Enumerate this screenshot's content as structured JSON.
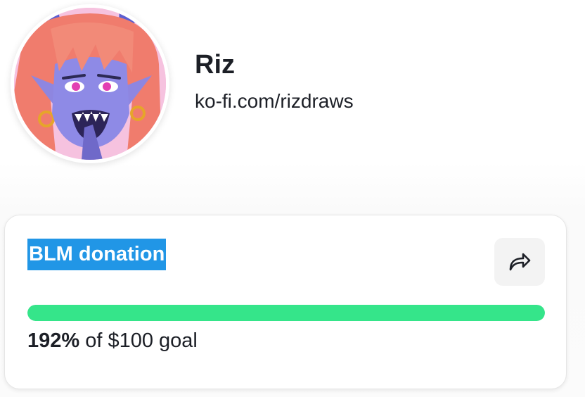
{
  "profile": {
    "name": "Riz",
    "url": "ko-fi.com/rizdraws",
    "avatar_alt": "avatar"
  },
  "goal": {
    "title": "BLM donation",
    "percent_label": "192%",
    "goal_text": " of $100 goal",
    "progress_fraction": 1.0,
    "share_icon": "share-arrow-icon"
  },
  "colors": {
    "progress": "#35e58a",
    "title_highlight": "#2196e6"
  }
}
